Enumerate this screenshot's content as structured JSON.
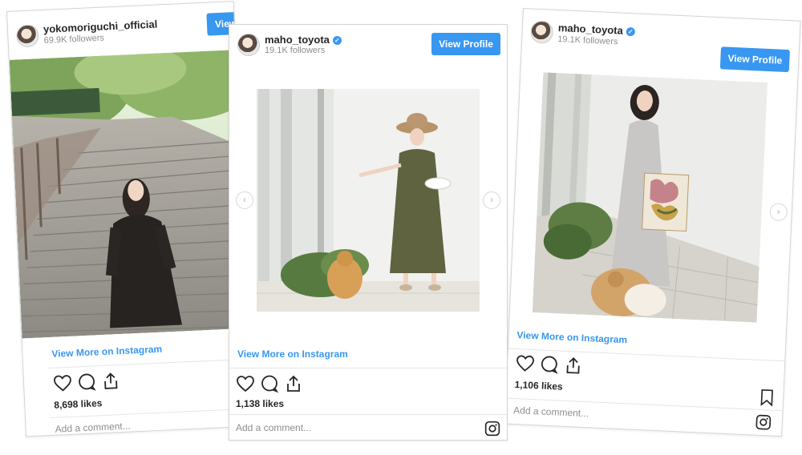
{
  "posts": [
    {
      "username": "yokomoriguchi_official",
      "followers": "69.9K followers",
      "verified": false,
      "view_profile": "View Profile",
      "view_more": "View More on Instagram",
      "likes": "8,698 likes",
      "comment_placeholder": "Add a comment..."
    },
    {
      "username": "maho_toyota",
      "followers": "19.1K followers",
      "verified": true,
      "view_profile": "View Profile",
      "view_more": "View More on Instagram",
      "likes": "1,138 likes",
      "comment_placeholder": "Add a comment..."
    },
    {
      "username": "maho_toyota",
      "followers": "19.1K followers",
      "verified": true,
      "view_profile": "View Profile",
      "view_more": "View More on Instagram",
      "likes": "1,106 likes",
      "comment_placeholder": "Add a comment..."
    }
  ],
  "icons": [
    "heart-icon",
    "comment-icon",
    "share-icon",
    "bookmark-icon",
    "instagram-icon",
    "chevron-left-icon",
    "chevron-right-icon",
    "verified-badge-icon"
  ],
  "colors": {
    "accent": "#3897f0",
    "text": "#262626",
    "muted": "#8e8e8e",
    "border": "#d4d4d4"
  }
}
